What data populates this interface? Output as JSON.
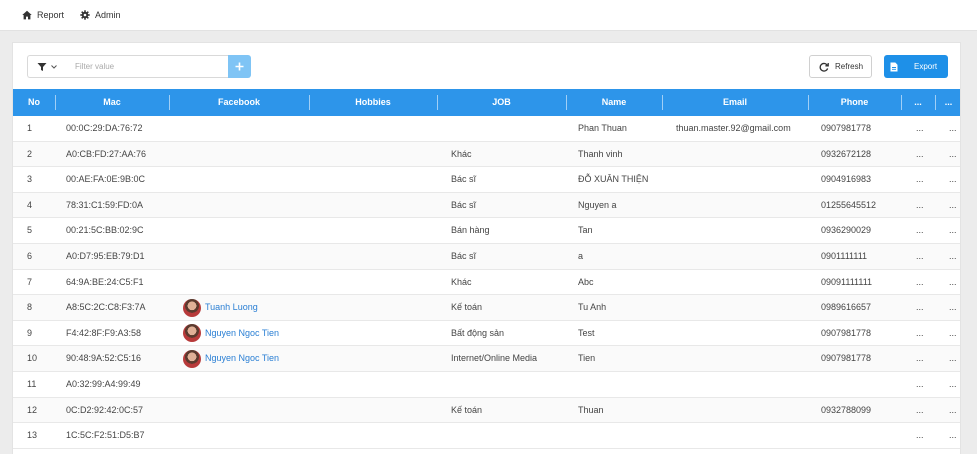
{
  "nav": {
    "report_label": "Report",
    "admin_label": "Admin"
  },
  "toolbar": {
    "filter_placeholder": "Filter value",
    "refresh_label": "Refresh",
    "export_label": "Export"
  },
  "colors": {
    "header_bg": "#2d95ea",
    "export_bg": "#1e90e8",
    "add_bg": "#7fc4f5",
    "link": "#2a7fd4"
  },
  "table": {
    "columns": [
      "No",
      "Mac",
      "Facebook",
      "Hobbies",
      "JOB",
      "Name",
      "Email",
      "Phone",
      "...",
      "..."
    ],
    "rows": [
      {
        "no": "1",
        "mac": "00:0C:29:DA:76:72",
        "facebook": "",
        "job": "",
        "name": "Phan Thuan",
        "email": "thuan.master.92@gmail.com",
        "phone": "0907981778",
        "c9": "...",
        "c10": "..."
      },
      {
        "no": "2",
        "mac": "A0:CB:FD:27:AA:76",
        "facebook": "",
        "job": "Khác",
        "name": "Thanh vinh",
        "email": "",
        "phone": "0932672128",
        "c9": "...",
        "c10": "..."
      },
      {
        "no": "3",
        "mac": "00:AE:FA:0E:9B:0C",
        "facebook": "",
        "job": "Bác sĩ",
        "name": "ĐỖ XUÂN THIỆN",
        "email": "",
        "phone": "0904916983",
        "c9": "...",
        "c10": "..."
      },
      {
        "no": "4",
        "mac": "78:31:C1:59:FD:0A",
        "facebook": "",
        "job": "Bác sĩ",
        "name": "Nguyen a",
        "email": "",
        "phone": "01255645512",
        "c9": "...",
        "c10": "..."
      },
      {
        "no": "5",
        "mac": "00:21:5C:BB:02:9C",
        "facebook": "",
        "job": "Bán hàng",
        "name": "Tan",
        "email": "",
        "phone": "0936290029",
        "c9": "...",
        "c10": "..."
      },
      {
        "no": "6",
        "mac": "A0:D7:95:EB:79:D1",
        "facebook": "",
        "job": "Bác sĩ",
        "name": "a",
        "email": "",
        "phone": "0901111111",
        "c9": "...",
        "c10": "..."
      },
      {
        "no": "7",
        "mac": "64:9A:BE:24:C5:F1",
        "facebook": "",
        "job": "Khác",
        "name": "Abc",
        "email": "",
        "phone": "09091111111",
        "c9": "...",
        "c10": "..."
      },
      {
        "no": "8",
        "mac": "A8:5C:2C:C8:F3:7A",
        "facebook": "Tuanh Luong",
        "job": "Kế toán",
        "name": "Tu Anh",
        "email": "",
        "phone": "0989616657",
        "c9": "...",
        "c10": "..."
      },
      {
        "no": "9",
        "mac": "F4:42:8F:F9:A3:58",
        "facebook": "Nguyen Ngoc Tien",
        "job": "Bất động sản",
        "name": "Test",
        "email": "",
        "phone": "0907981778",
        "c9": "...",
        "c10": "..."
      },
      {
        "no": "10",
        "mac": "90:48:9A:52:C5:16",
        "facebook": "Nguyen Ngoc Tien",
        "job": "Internet/Online Media",
        "name": "Tien",
        "email": "",
        "phone": "0907981778",
        "c9": "...",
        "c10": "..."
      },
      {
        "no": "11",
        "mac": "A0:32:99:A4:99:49",
        "facebook": "",
        "job": "",
        "name": "",
        "email": "",
        "phone": "",
        "c9": "...",
        "c10": "..."
      },
      {
        "no": "12",
        "mac": "0C:D2:92:42:0C:57",
        "facebook": "",
        "job": "Kế toán",
        "name": "Thuan",
        "email": "",
        "phone": "0932788099",
        "c9": "...",
        "c10": "..."
      },
      {
        "no": "13",
        "mac": "1C:5C:F2:51:D5:B7",
        "facebook": "",
        "job": "",
        "name": "",
        "email": "",
        "phone": "",
        "c9": "...",
        "c10": "..."
      }
    ]
  }
}
